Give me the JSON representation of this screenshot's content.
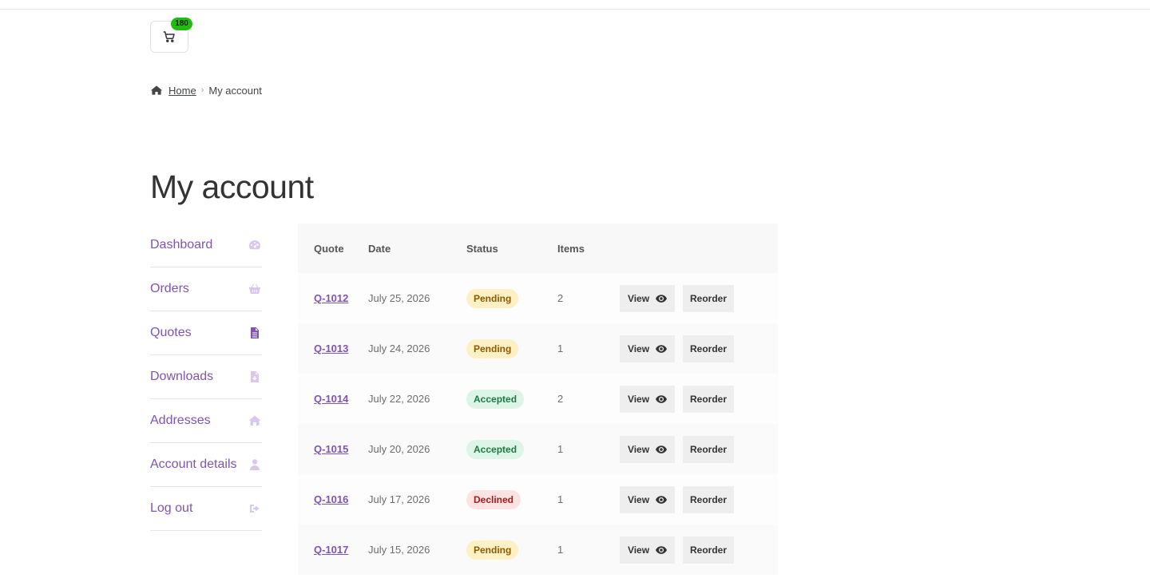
{
  "cart": {
    "count": "180",
    "icon": "cart-icon"
  },
  "breadcrumb": {
    "home": "Home",
    "separator": "›",
    "current": "My account"
  },
  "page": {
    "title": "My account"
  },
  "nav": {
    "items": [
      {
        "label": "Dashboard",
        "icon": "dashboard-icon"
      },
      {
        "label": "Orders",
        "icon": "basket-icon"
      },
      {
        "label": "Quotes",
        "icon": "document-icon",
        "active": true
      },
      {
        "label": "Downloads",
        "icon": "download-file-icon"
      },
      {
        "label": "Addresses",
        "icon": "home-icon"
      },
      {
        "label": "Account details",
        "icon": "user-icon"
      },
      {
        "label": "Log out",
        "icon": "logout-icon"
      }
    ]
  },
  "table": {
    "headers": {
      "quote": "Quote",
      "date": "Date",
      "status": "Status",
      "items": "Items"
    },
    "view_label": "View",
    "reorder_label": "Reorder",
    "rows": [
      {
        "quote": "Q-1012",
        "date": "July 25, 2026",
        "status": "Pending",
        "items": "2"
      },
      {
        "quote": "Q-1013",
        "date": "July 24, 2026",
        "status": "Pending",
        "items": "1"
      },
      {
        "quote": "Q-1014",
        "date": "July 22, 2026",
        "status": "Accepted",
        "items": "2"
      },
      {
        "quote": "Q-1015",
        "date": "July 20, 2026",
        "status": "Accepted",
        "items": "1"
      },
      {
        "quote": "Q-1016",
        "date": "July 17, 2026",
        "status": "Declined",
        "items": "1"
      },
      {
        "quote": "Q-1017",
        "date": "July 15, 2026",
        "status": "Pending",
        "items": "1"
      }
    ]
  },
  "colors": {
    "accent": "#7f54b3",
    "badge_green": "#1fbe0c",
    "pending_bg": "#fdf0c4",
    "accepted_bg": "#dcf5e6",
    "declined_bg": "#fde2e2"
  }
}
